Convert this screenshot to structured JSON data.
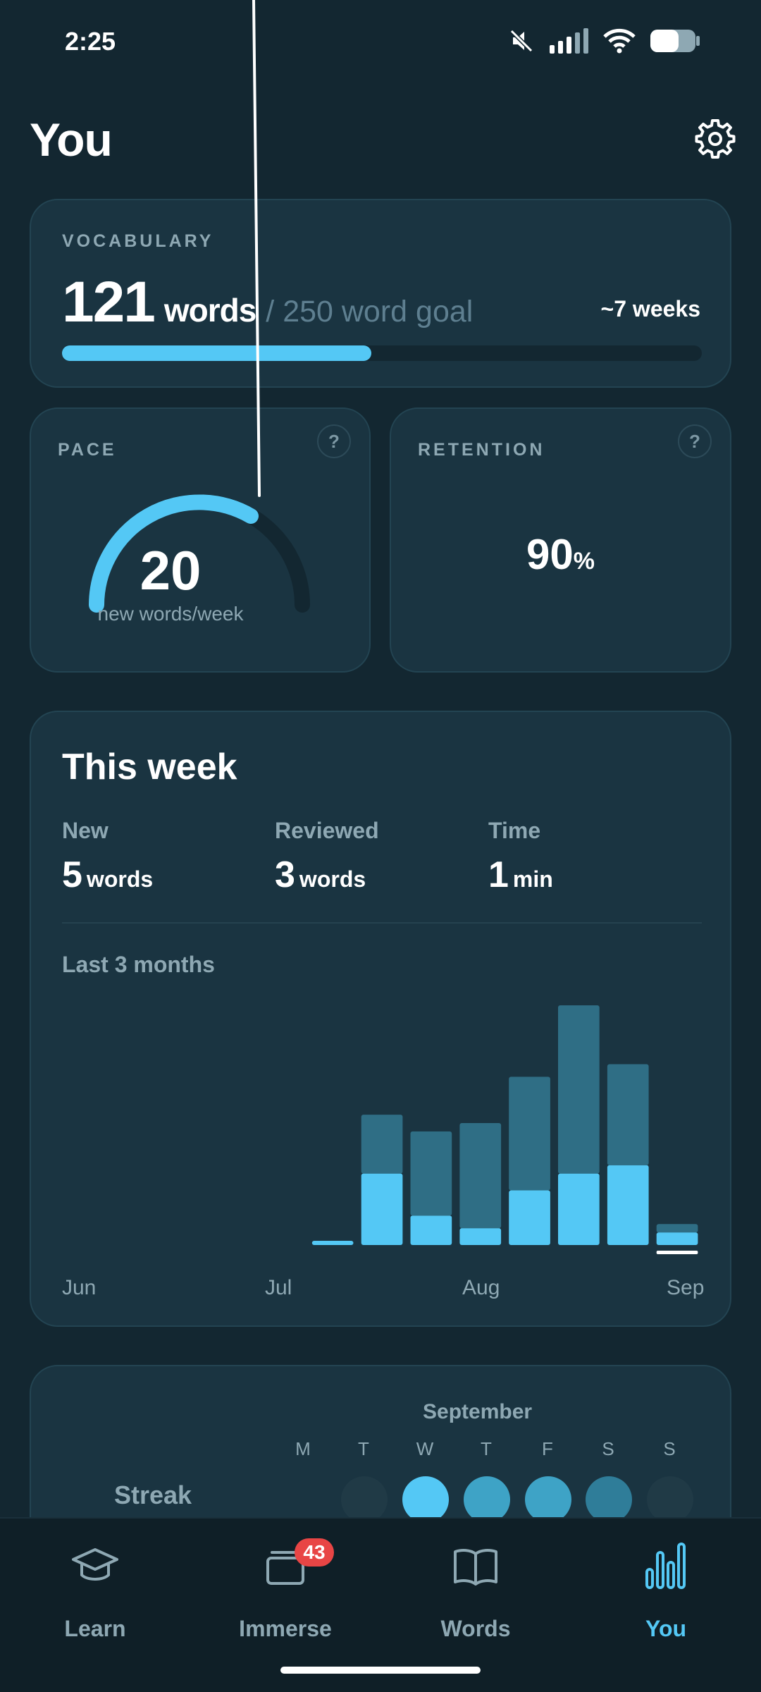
{
  "status_bar": {
    "time": "2:25",
    "icons": [
      "mute-icon",
      "signal-icon",
      "wifi-icon",
      "battery-icon"
    ]
  },
  "header": {
    "title": "You",
    "settings_icon": "gear-icon"
  },
  "vocabulary": {
    "label": "VOCABULARY",
    "count": "121",
    "unit": "words",
    "goal_text": "/ 250 word goal",
    "eta": "~7 weeks",
    "progress_value": 121,
    "progress_goal": 250
  },
  "pace": {
    "label": "PACE",
    "help": "?",
    "value": "20",
    "unit": "new words/week"
  },
  "retention": {
    "label": "RETENTION",
    "help": "?",
    "value": "90",
    "unit": "%",
    "percent": 90
  },
  "this_week": {
    "title": "This week",
    "stats": [
      {
        "label": "New",
        "value": "5",
        "unit": "words"
      },
      {
        "label": "Reviewed",
        "value": "3",
        "unit": "words"
      },
      {
        "label": "Time",
        "value": "1",
        "unit": "min"
      }
    ],
    "range_label": "Last 3 months"
  },
  "chart_data": {
    "type": "bar",
    "stacked": true,
    "x_labels": [
      "Jun",
      "Jul",
      "Aug",
      "Sep"
    ],
    "series": [
      {
        "values": [
          0,
          0,
          0,
          0,
          0,
          1,
          17,
          7,
          4,
          13,
          17,
          19,
          3
        ]
      },
      {
        "values": [
          0,
          0,
          0,
          0,
          0,
          0,
          14,
          20,
          25,
          27,
          40,
          24,
          2
        ]
      }
    ],
    "colors": {
      "lower": "#54c8f5",
      "upper": "#2f6e85",
      "current_week_marker": "#ffffff"
    },
    "current_week_index": 12
  },
  "streak": {
    "label": "Streak",
    "month": "September",
    "days": [
      "M",
      "T",
      "W",
      "T",
      "F",
      "S",
      "S"
    ],
    "day_states": [
      "none",
      "empty",
      "bright",
      "medium",
      "medium",
      "dim",
      "empty"
    ]
  },
  "nav": {
    "items": [
      {
        "label": "Learn",
        "icon": "graduation-cap-icon"
      },
      {
        "label": "Immerse",
        "icon": "tv-icon",
        "badge": "43"
      },
      {
        "label": "Words",
        "icon": "open-book-icon"
      },
      {
        "label": "You",
        "icon": "bar-chart-icon",
        "active": true
      }
    ]
  }
}
